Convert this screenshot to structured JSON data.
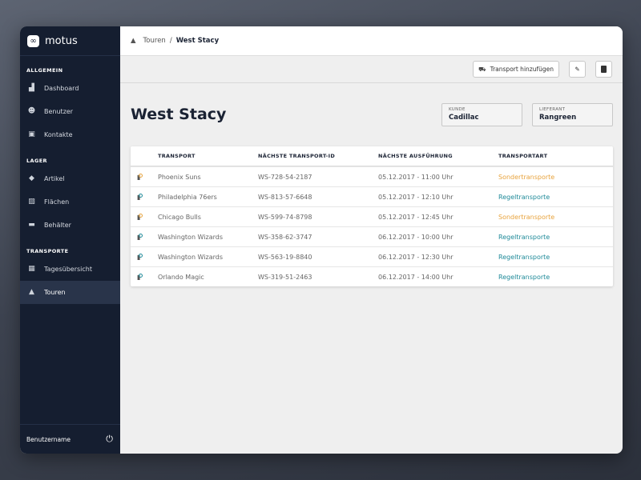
{
  "app": {
    "name": "motus"
  },
  "sidebar": {
    "sections": [
      {
        "title": "ALLGEMEIN",
        "items": [
          {
            "label": "Dashboard",
            "icon": "chart-icon"
          },
          {
            "label": "Benutzer",
            "icon": "users-icon"
          },
          {
            "label": "Kontakte",
            "icon": "contacts-icon"
          }
        ]
      },
      {
        "title": "LAGER",
        "items": [
          {
            "label": "Artikel",
            "icon": "tag-icon"
          },
          {
            "label": "Flächen",
            "icon": "area-icon"
          },
          {
            "label": "Behälter",
            "icon": "box-icon"
          }
        ]
      },
      {
        "title": "TRANSPORTE",
        "items": [
          {
            "label": "Tagesübersicht",
            "icon": "calendar-icon"
          },
          {
            "label": "Touren",
            "icon": "road-icon"
          }
        ]
      }
    ],
    "username": "Benutzername"
  },
  "breadcrumb": {
    "parent": "Touren",
    "separator": "/",
    "current": "West Stacy"
  },
  "toolbar": {
    "add_label": "Transport hinzufügen"
  },
  "page": {
    "title": "West Stacy",
    "kunde_label": "KUNDE",
    "kunde": "Cadillac",
    "lieferant_label": "LIEFERANT",
    "lieferant": "Rangreen"
  },
  "table": {
    "headers": [
      "TRANSPORT",
      "NÄCHSTE TRANSPORT-ID",
      "NÄCHSTE AUSFÜHRUNG",
      "TRANSPORTART"
    ],
    "rows": [
      [
        "Phoenix Suns",
        "WS-728-54-2187",
        "05.12.2017 - 11:00 Uhr",
        "Sondertransporte"
      ],
      [
        "Philadelphia 76ers",
        "WS-813-57-6648",
        "05.12.2017 - 12:10 Uhr",
        "Regeltransporte"
      ],
      [
        "Chicago Bulls",
        "WS-599-74-8798",
        "05.12.2017 - 12:45 Uhr",
        "Sondertransporte"
      ],
      [
        "Washington Wizards",
        "WS-358-62-3747",
        "06.12.2017 - 10:00 Uhr",
        "Regeltransporte"
      ],
      [
        "Washington Wizards",
        "WS-563-19-8840",
        "06.12.2017 - 12:30 Uhr",
        "Regeltransporte"
      ],
      [
        "Orlando Magic",
        "WS-319-51-2463",
        "06.12.2017 - 14:00 Uhr",
        "Regeltransporte"
      ]
    ]
  },
  "colors": {
    "sonder": "#e8a33d",
    "regel": "#1f8a99",
    "sidebar": "#151e30"
  }
}
